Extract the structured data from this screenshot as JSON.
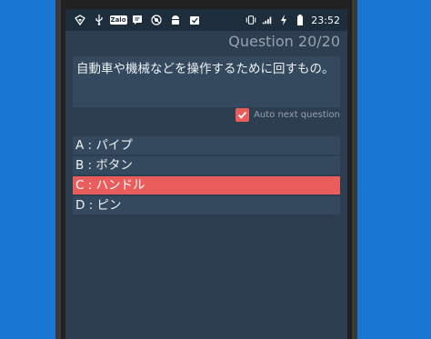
{
  "status_bar": {
    "left_icons": [
      "wifi-icon",
      "usb-icon",
      "zalo-icon",
      "message-icon",
      "no-signal-icon",
      "android-icon",
      "task-check-icon"
    ],
    "zalo_label": "Zalo",
    "right_icons": [
      "vibrate-icon",
      "cell-signal-icon",
      "battery-charging-icon"
    ],
    "time": "23:52"
  },
  "quiz": {
    "progress": "Question 20/20",
    "question": "自動車や機械などを操作するために回すもの。",
    "auto_next_label": "Auto next question",
    "auto_next_checked": true,
    "answers": [
      {
        "label": "A : パイプ",
        "selected": false
      },
      {
        "label": "B : ボタン",
        "selected": false
      },
      {
        "label": "C : ハンドル",
        "selected": true
      },
      {
        "label": "D : ピン",
        "selected": false
      }
    ]
  },
  "colors": {
    "background": "#1976d2",
    "screen": "#2c3e50",
    "card": "#34495e",
    "accent": "#ea5d5d"
  }
}
